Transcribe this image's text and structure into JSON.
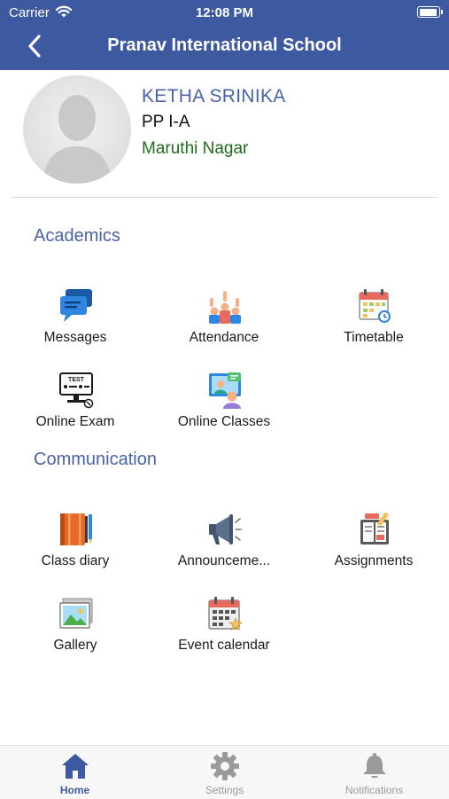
{
  "status_bar": {
    "carrier": "Carrier",
    "time": "12:08 PM"
  },
  "header": {
    "title": "Pranav International School"
  },
  "profile": {
    "name": "KETHA SRINIKA",
    "class": "PP I-A",
    "branch": "Maruthi Nagar"
  },
  "sections": {
    "academics": {
      "title": "Academics",
      "items": [
        {
          "label": "Messages",
          "icon": "messages-icon"
        },
        {
          "label": "Attendance",
          "icon": "attendance-icon"
        },
        {
          "label": "Timetable",
          "icon": "timetable-icon"
        },
        {
          "label": "Online Exam",
          "icon": "online-exam-icon"
        },
        {
          "label": "Online Classes",
          "icon": "online-classes-icon"
        }
      ]
    },
    "communication": {
      "title": "Communication",
      "items": [
        {
          "label": "Class diary",
          "icon": "class-diary-icon"
        },
        {
          "label": "Announceme...",
          "icon": "announcement-icon"
        },
        {
          "label": "Assignments",
          "icon": "assignments-icon"
        },
        {
          "label": "Gallery",
          "icon": "gallery-icon"
        },
        {
          "label": "Event calendar",
          "icon": "event-calendar-icon"
        }
      ]
    }
  },
  "tabbar": {
    "active": "home",
    "tabs": [
      {
        "label": "Home",
        "icon": "home-icon"
      },
      {
        "label": "Settings",
        "icon": "gear-icon"
      },
      {
        "label": "Notifications",
        "icon": "bell-icon"
      }
    ]
  },
  "colors": {
    "primary": "#3d5aa1",
    "name_text": "#4a63a8",
    "branch_text": "#1f6b1f",
    "tab_inactive": "#9a9a9a"
  }
}
